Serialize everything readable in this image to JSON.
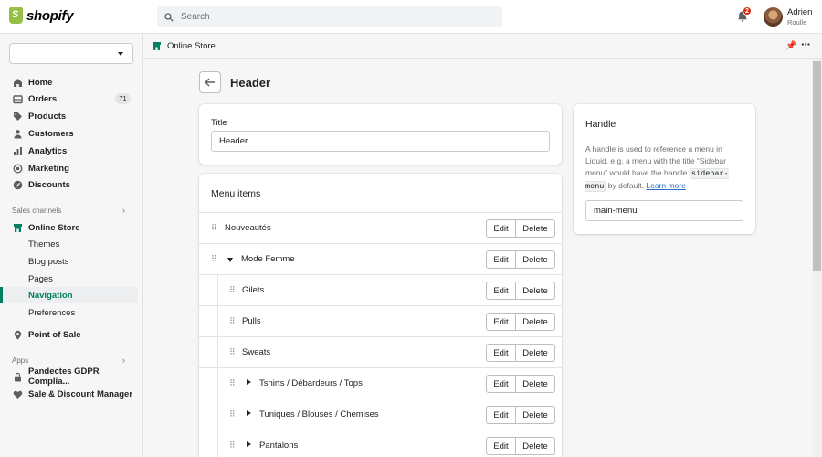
{
  "brand": {
    "name": "shopify",
    "color": "#95bf47"
  },
  "search": {
    "placeholder": "Search"
  },
  "notifications": {
    "count": "2"
  },
  "user": {
    "name": "Adrien",
    "subtitle": "Roulle"
  },
  "sidebar": {
    "store_select": "",
    "items": [
      {
        "label": "Home",
        "icon": "home-icon"
      },
      {
        "label": "Orders",
        "icon": "orders-icon",
        "count": "71"
      },
      {
        "label": "Products",
        "icon": "tag-icon"
      },
      {
        "label": "Customers",
        "icon": "person-icon"
      },
      {
        "label": "Analytics",
        "icon": "bar-chart-icon"
      },
      {
        "label": "Marketing",
        "icon": "target-icon"
      },
      {
        "label": "Discounts",
        "icon": "discount-icon"
      }
    ],
    "sales_channels_label": "Sales channels",
    "online_store": {
      "label": "Online Store",
      "icon": "store-icon"
    },
    "online_store_sub": [
      "Themes",
      "Blog posts",
      "Pages",
      "Navigation",
      "Preferences"
    ],
    "point_of_sale": {
      "label": "Point of Sale",
      "icon": "pin-location-icon"
    },
    "apps_label": "Apps",
    "apps": [
      {
        "label": "Pandectes GDPR Complia...",
        "icon": "lock-icon"
      },
      {
        "label": "Sale & Discount Manager",
        "icon": "heart-tag-icon"
      }
    ]
  },
  "breadcrumb": {
    "label": "Online Store"
  },
  "page": {
    "title": "Header"
  },
  "title_card": {
    "label": "Title",
    "value": "Header"
  },
  "menu_items": {
    "heading": "Menu items",
    "edit_label": "Edit",
    "delete_label": "Delete",
    "rows": [
      {
        "label": "Nouveautés",
        "depth": 0,
        "toggle": "none"
      },
      {
        "label": "Mode Femme",
        "depth": 0,
        "toggle": "expanded"
      },
      {
        "label": "Gilets",
        "depth": 1,
        "toggle": "none"
      },
      {
        "label": "Pulls",
        "depth": 1,
        "toggle": "none"
      },
      {
        "label": "Sweats",
        "depth": 1,
        "toggle": "none"
      },
      {
        "label": "Tshirts / Débardeurs / Tops",
        "depth": 1,
        "toggle": "collapsed"
      },
      {
        "label": "Tuniques / Blouses / Chemises",
        "depth": 1,
        "toggle": "collapsed"
      },
      {
        "label": "Pantalons",
        "depth": 1,
        "toggle": "collapsed"
      }
    ]
  },
  "handle_card": {
    "heading": "Handle",
    "desc_before": "A handle is used to reference a menu in Liquid. e.g. a menu with the title “Sidebar menu” would have the handle ",
    "desc_code": "sidebar-menu",
    "desc_after": " by default. ",
    "learn_more": "Learn more",
    "value": "main-menu"
  }
}
